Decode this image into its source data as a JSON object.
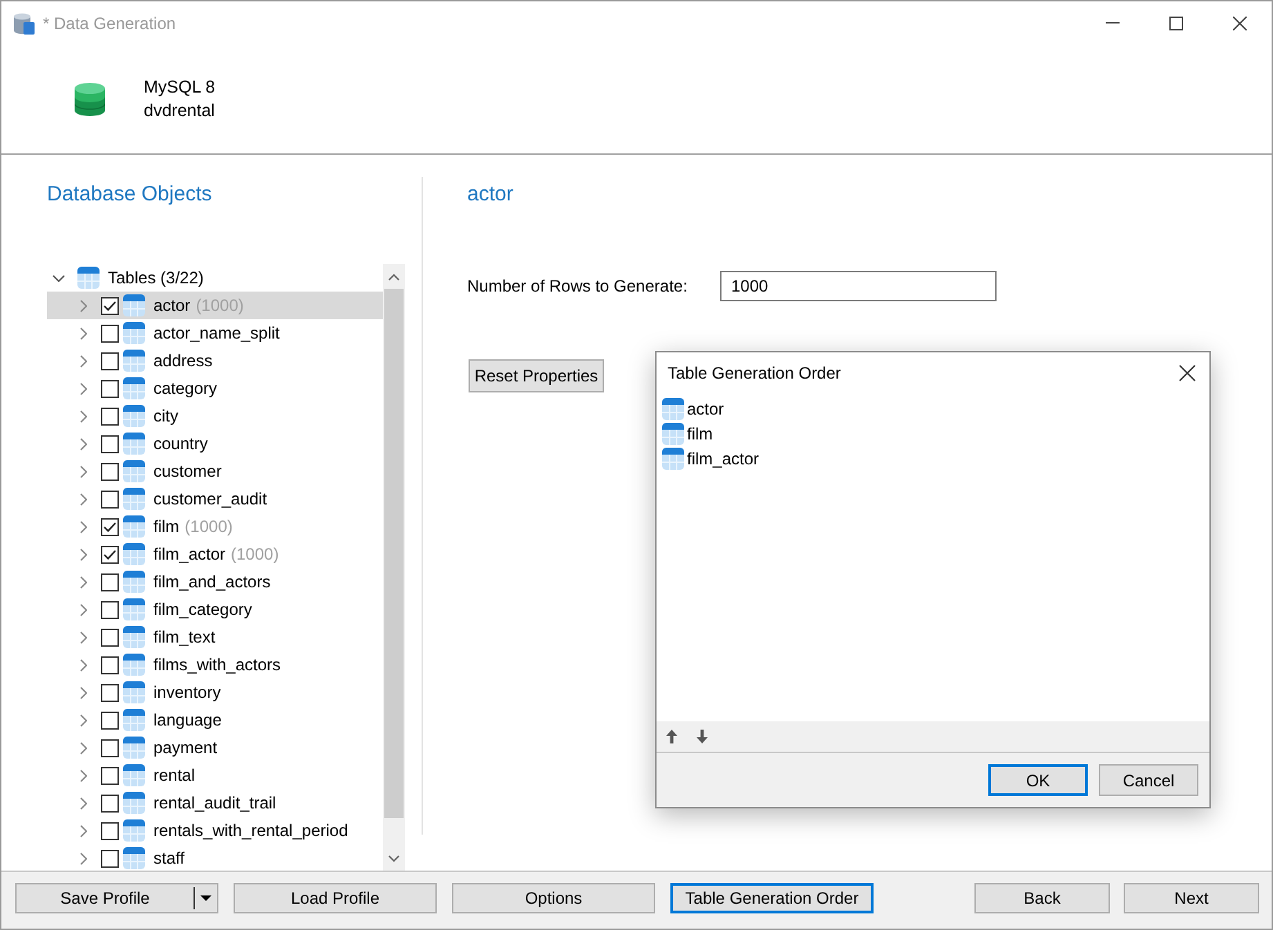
{
  "window": {
    "title": "* Data Generation"
  },
  "header": {
    "server": "MySQL 8",
    "database": "dvdrental"
  },
  "objects_panel": {
    "heading": "Database Objects",
    "tree": {
      "label": "Tables (3/22)",
      "expanded": true,
      "children": [
        {
          "name": "actor",
          "count": "(1000)",
          "checked": true,
          "selected": true,
          "expanded": false
        },
        {
          "name": "actor_name_split",
          "checked": false,
          "selected": false,
          "expanded": false
        },
        {
          "name": "address",
          "checked": false,
          "selected": false,
          "expanded": false
        },
        {
          "name": "category",
          "checked": false,
          "selected": false,
          "expanded": false
        },
        {
          "name": "city",
          "checked": false,
          "selected": false,
          "expanded": false
        },
        {
          "name": "country",
          "checked": false,
          "selected": false,
          "expanded": false
        },
        {
          "name": "customer",
          "checked": false,
          "selected": false,
          "expanded": false
        },
        {
          "name": "customer_audit",
          "checked": false,
          "selected": false,
          "expanded": false
        },
        {
          "name": "film",
          "count": "(1000)",
          "checked": true,
          "selected": false,
          "expanded": false
        },
        {
          "name": "film_actor",
          "count": "(1000)",
          "checked": true,
          "selected": false,
          "expanded": false
        },
        {
          "name": "film_and_actors",
          "checked": false,
          "selected": false,
          "expanded": false
        },
        {
          "name": "film_category",
          "checked": false,
          "selected": false,
          "expanded": false
        },
        {
          "name": "film_text",
          "checked": false,
          "selected": false,
          "expanded": false
        },
        {
          "name": "films_with_actors",
          "checked": false,
          "selected": false,
          "expanded": false
        },
        {
          "name": "inventory",
          "checked": false,
          "selected": false,
          "expanded": false
        },
        {
          "name": "language",
          "checked": false,
          "selected": false,
          "expanded": false
        },
        {
          "name": "payment",
          "checked": false,
          "selected": false,
          "expanded": false
        },
        {
          "name": "rental",
          "checked": false,
          "selected": false,
          "expanded": false
        },
        {
          "name": "rental_audit_trail",
          "checked": false,
          "selected": false,
          "expanded": false
        },
        {
          "name": "rentals_with_rental_period",
          "checked": false,
          "selected": false,
          "expanded": false
        },
        {
          "name": "staff",
          "checked": false,
          "selected": false,
          "expanded": false
        }
      ]
    }
  },
  "properties_panel": {
    "heading": "actor",
    "rows_label": "Number of Rows to Generate:",
    "rows_value": "1000",
    "reset_button": "Reset Properties"
  },
  "dialog": {
    "title": "Table Generation Order",
    "items": [
      "actor",
      "film",
      "film_actor"
    ],
    "buttons": [
      {
        "label": "OK",
        "focused": true
      },
      {
        "label": "Cancel",
        "focused": false
      }
    ]
  },
  "bottom_bar": {
    "left_buttons": [
      {
        "label": "Save Profile",
        "kind": "split",
        "focused": false
      },
      {
        "label": "Load Profile",
        "kind": "push",
        "focused": false
      },
      {
        "label": "Options",
        "kind": "push",
        "focused": false
      },
      {
        "label": "Table Generation Order",
        "kind": "push",
        "focused": true
      }
    ],
    "right_buttons": [
      {
        "label": "Back",
        "kind": "push",
        "focused": false
      },
      {
        "label": "Next",
        "kind": "push",
        "focused": false
      }
    ]
  }
}
